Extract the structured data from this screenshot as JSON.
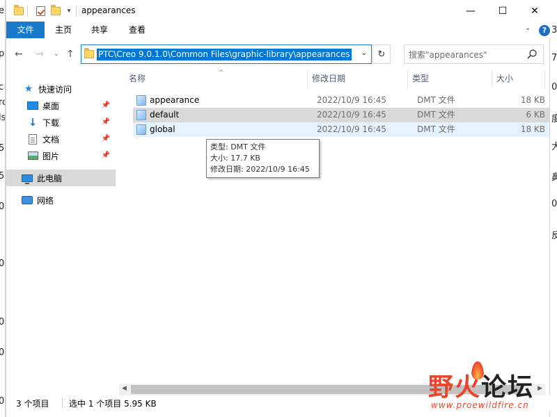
{
  "titlebar": {
    "title": "appearances",
    "buttons": {
      "minimize": "—",
      "maximize": "☐",
      "close": "✕"
    }
  },
  "ribbon": {
    "tabs": [
      "文件",
      "主页",
      "共享",
      "查看"
    ],
    "expand_icon": "chevron-down",
    "help_label": "?"
  },
  "address": {
    "path": "PTC\\Creo 9.0.1.0\\Common Files\\graphic-library\\appearances",
    "search_placeholder": "搜索\"appearances\""
  },
  "navigation": {
    "items": [
      {
        "label": "快速访问",
        "icon": "star-icon",
        "pinned": false
      },
      {
        "label": "桌面",
        "icon": "desktop-icon",
        "pinned": true
      },
      {
        "label": "下载",
        "icon": "download-icon",
        "pinned": true
      },
      {
        "label": "文档",
        "icon": "document-icon",
        "pinned": true
      },
      {
        "label": "图片",
        "icon": "picture-icon",
        "pinned": true
      },
      {
        "label": "此电脑",
        "icon": "computer-icon",
        "pinned": false,
        "selected": true
      },
      {
        "label": "网络",
        "icon": "network-icon",
        "pinned": false
      }
    ]
  },
  "file_list": {
    "columns": [
      "名称",
      "修改日期",
      "类型",
      "大小"
    ],
    "files": [
      {
        "name": "appearance",
        "date": "2022/10/9 16:45",
        "type": "DMT 文件",
        "size": "18 KB"
      },
      {
        "name": "default",
        "date": "2022/10/9 16:45",
        "type": "DMT 文件",
        "size": "6 KB",
        "selected": true
      },
      {
        "name": "global",
        "date": "2022/10/9 16:45",
        "type": "DMT 文件",
        "size": "18 KB",
        "hover": true
      }
    ]
  },
  "tooltip": {
    "line1": "类型: DMT 文件",
    "line2": "大小: 17.7 KB",
    "line3": "修改日期: 2022/10/9 16:45"
  },
  "status": {
    "count": "3 个项目",
    "selection": "选中 1 个项目  5.95 KB"
  },
  "watermark": {
    "text_a": "野火",
    "text_b": "论坛",
    "url": "www.proewildfire.cn"
  },
  "colors": {
    "accent": "#1979ca",
    "selection": "#0078d7",
    "hover_row": "#e5f3ff",
    "selected_row": "#d9d9d9",
    "watermark_red": "#e8452c"
  }
}
